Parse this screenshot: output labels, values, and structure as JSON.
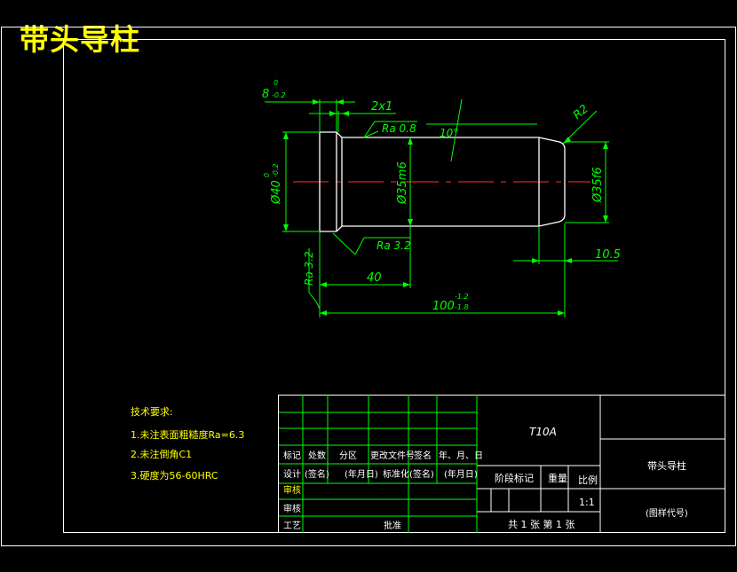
{
  "title": "带头导柱",
  "dims": {
    "head_thk": "8",
    "head_thk_up": "0",
    "head_thk_low": "-0.2",
    "chamfer": "2x1",
    "ra_top": "Ra 0.8",
    "angle": "10°",
    "radius": "R2",
    "head_dia_prefix": "Ø40",
    "head_dia_up": "0",
    "head_dia_low": "-0.2",
    "body_dia": "Ø35m6",
    "end_dia": "Ø35f6",
    "ra_under": "Ra 3.2",
    "ra_left": "Ra 3.2",
    "len40": "40",
    "len10": "10.5",
    "len100": "100",
    "len100_up": "-1.2",
    "len100_low": "-1.8"
  },
  "notes": {
    "heading": "技术要求:",
    "items": [
      "1.未注表面粗糙度Ra=6.3",
      "2.未注倒角C1",
      "3.硬度为56-60HRC"
    ]
  },
  "titleblock": {
    "material": "T10A",
    "part_name": "带头导柱",
    "drawing_code": "(图样代号)",
    "row_labels": [
      "标记",
      "处数",
      "分区",
      "更改文件号",
      "签名",
      "年、月、日"
    ],
    "design": "设计",
    "sign1": "(签名)",
    "date1": "(年月日)",
    "std": "标准化",
    "sign2": "(签名)",
    "date2": "(年月日)",
    "check": "审核",
    "audit": "审核",
    "process": "工艺",
    "approve": "批准",
    "stage_mark": "阶段标记",
    "weight": "重量",
    "scale": "比例",
    "scale_val": "1:1",
    "sheets": "共 1 张    第 1 张"
  }
}
